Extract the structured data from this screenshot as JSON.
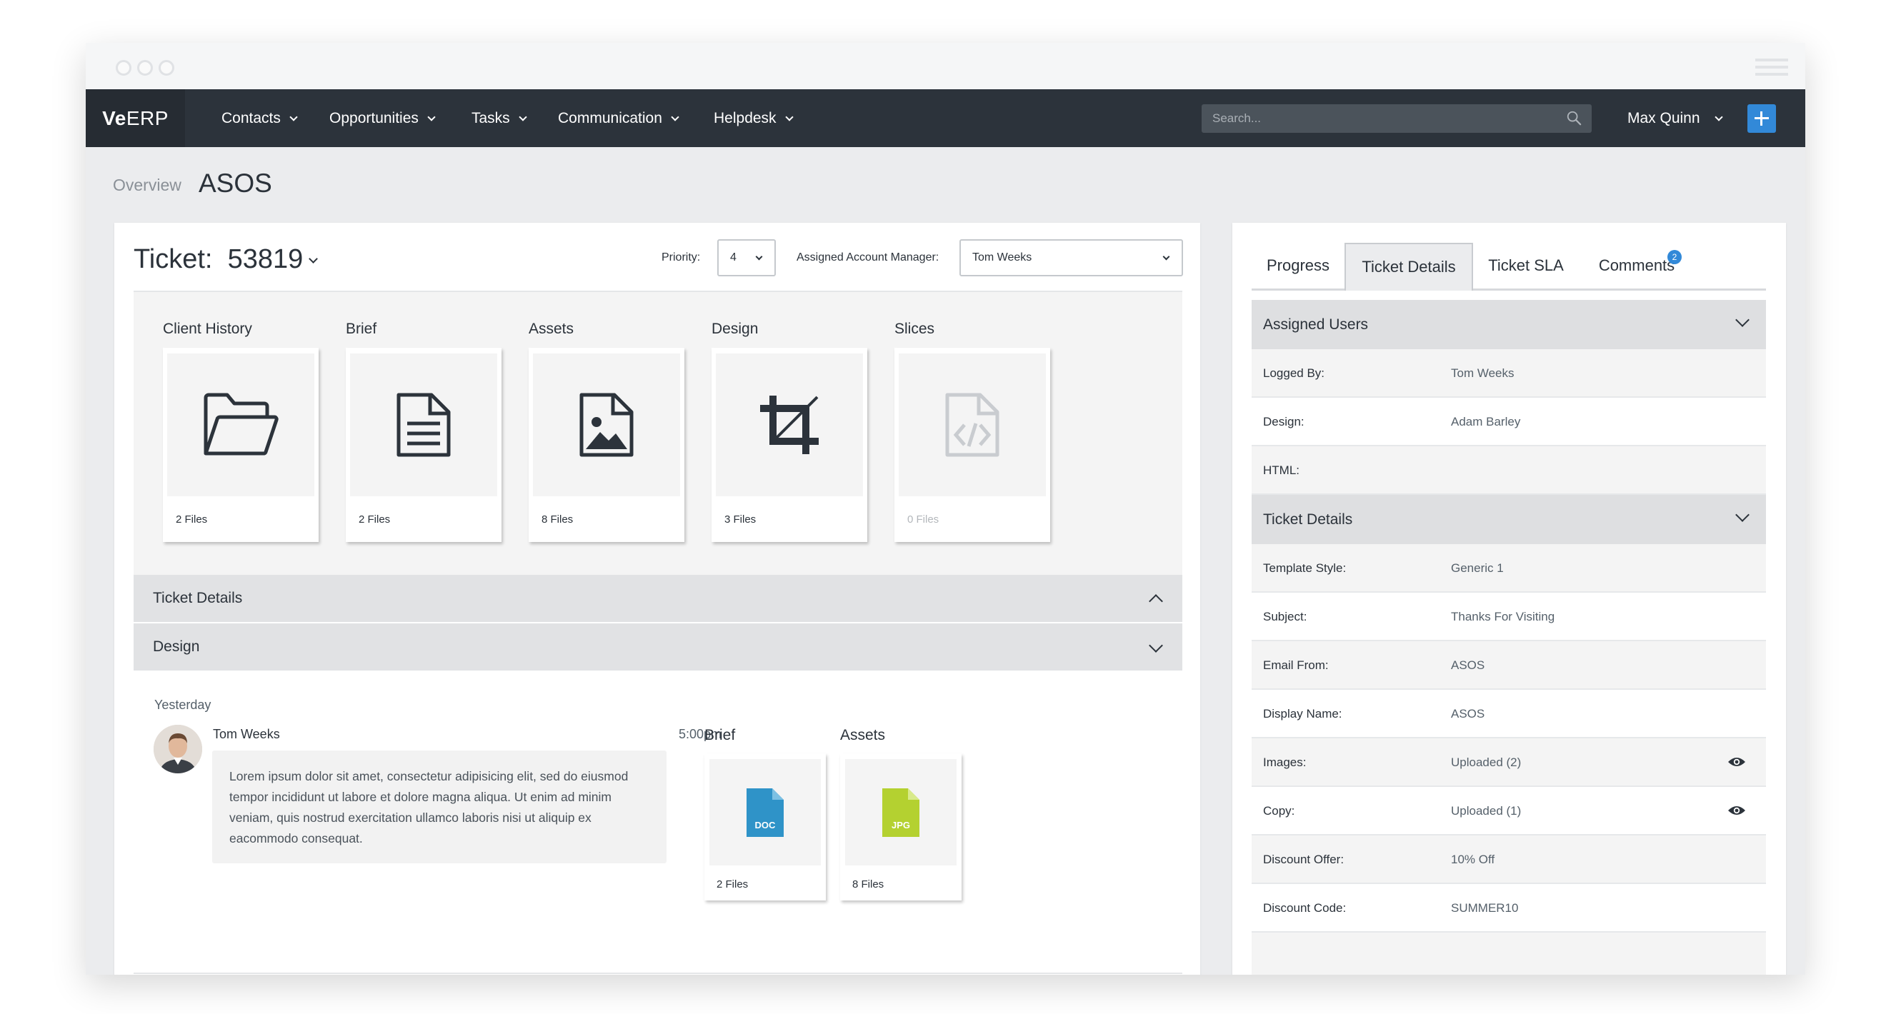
{
  "app": {
    "brand_prefix": "Ve",
    "brand_suffix": "ERP"
  },
  "nav": {
    "items": [
      {
        "label": "Contacts"
      },
      {
        "label": "Opportunities"
      },
      {
        "label": "Tasks"
      },
      {
        "label": "Communication"
      },
      {
        "label": "Helpdesk"
      }
    ],
    "search_placeholder": "Search...",
    "user_name": "Max Quinn"
  },
  "page": {
    "breadcrumb": "Overview",
    "title": "ASOS"
  },
  "ticket": {
    "label": "Ticket:",
    "number": "53819",
    "priority_label": "Priority:",
    "priority_value": "4",
    "manager_label": "Assigned Account Manager:",
    "manager_value": "Tom Weeks"
  },
  "file_categories": [
    {
      "label": "Client History",
      "count": "2 Files",
      "icon": "folder-icon"
    },
    {
      "label": "Brief",
      "count": "2 Files",
      "icon": "document-icon"
    },
    {
      "label": "Assets",
      "count": "8 Files",
      "icon": "image-icon"
    },
    {
      "label": "Design",
      "count": "3 Files",
      "icon": "crop-icon"
    },
    {
      "label": "Slices",
      "count": "0 Files",
      "icon": "code-file-icon"
    }
  ],
  "sections": {
    "ticket_details": "Ticket Details",
    "design": "Design"
  },
  "feed": {
    "date": "Yesterday",
    "author": "Tom Weeks",
    "time": "5:00pm",
    "message": "Lorem ipsum dolor sit amet, consectetur adipisicing elit, sed do eiusmod tempor incididunt ut labore et dolore magna aliqua. Ut enim ad minim veniam, quis nostrud exercitation ullamco laboris nisi ut aliquip ex eacommodo consequat.",
    "attachments": [
      {
        "label": "Brief",
        "file_type": "DOC",
        "count": "2 Files",
        "color": "#2f93c8"
      },
      {
        "label": "Assets",
        "file_type": "JPG",
        "count": "8 Files",
        "color": "#b4d130"
      }
    ]
  },
  "right": {
    "tabs": [
      {
        "label": "Progress"
      },
      {
        "label": "Ticket Details"
      },
      {
        "label": "Ticket SLA"
      },
      {
        "label": "Comments",
        "badge": "2"
      }
    ],
    "assigned_users": {
      "title": "Assigned Users",
      "rows": [
        {
          "key": "Logged By:",
          "value": "Tom Weeks"
        },
        {
          "key": "Design:",
          "value": "Adam Barley"
        },
        {
          "key": "HTML:",
          "value": ""
        }
      ]
    },
    "ticket_details": {
      "title": "Ticket Details",
      "rows": [
        {
          "key": "Template Style:",
          "value": "Generic 1"
        },
        {
          "key": "Subject:",
          "value": "Thanks For Visiting"
        },
        {
          "key": "Email From:",
          "value": "ASOS"
        },
        {
          "key": "Display Name:",
          "value": "ASOS"
        },
        {
          "key": "Images:",
          "value": "Uploaded (2)"
        },
        {
          "key": "Copy:",
          "value": "Uploaded (1)"
        },
        {
          "key": "Discount Offer:",
          "value": "10% Off"
        },
        {
          "key": "Discount Code:",
          "value": "SUMMER10"
        }
      ]
    }
  },
  "colors": {
    "nav_bg": "#2c333b",
    "accent": "#3289d8",
    "page_bg": "#ebecee"
  }
}
